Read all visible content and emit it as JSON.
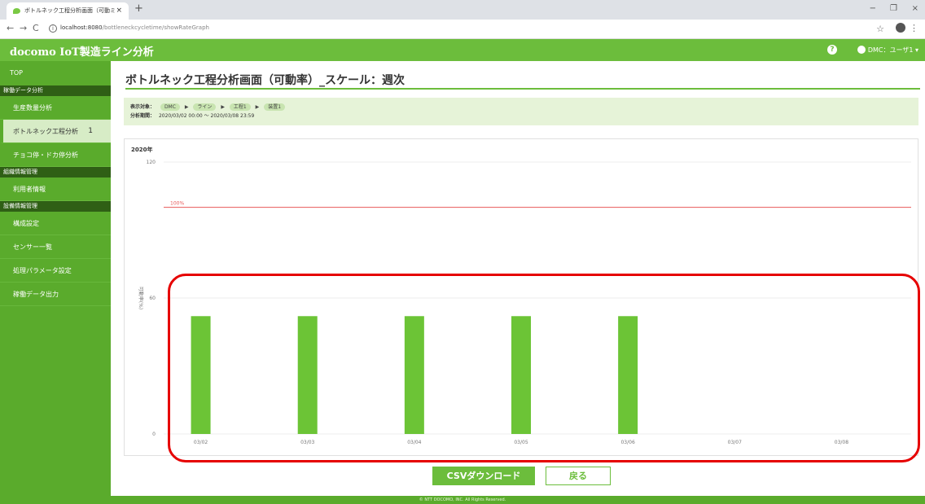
{
  "browser": {
    "tab_title": "ボトルネック工程分析画面（可動ミ",
    "tab_close": "×",
    "new_tab": "+",
    "url_host": "localhost:8080",
    "url_path": "/bottleneckcycletime/showRateGraph",
    "win_min": "−",
    "win_max": "❐",
    "win_close": "×",
    "nav_back": "←",
    "nav_fwd": "→",
    "nav_reload": "C",
    "info": "i",
    "star": "☆",
    "menu": "⋮"
  },
  "header": {
    "app_title": "docomo IoT製造ライン分析",
    "help": "?",
    "user": "DMC：ユーザ1 ▾"
  },
  "sidebar": {
    "top": "TOP",
    "sections": [
      {
        "title": "稼働データ分析",
        "items": [
          {
            "label": "生産数量分析"
          },
          {
            "label": "ボトルネック工程分析",
            "num": "1"
          },
          {
            "label": "チョコ停・ドカ停分析"
          }
        ]
      },
      {
        "title": "組織情報管理",
        "items": [
          {
            "label": "利用者情報"
          }
        ]
      },
      {
        "title": "設備情報管理",
        "items": [
          {
            "label": "構成設定"
          },
          {
            "label": "センサー一覧"
          },
          {
            "label": "処理パラメータ設定"
          },
          {
            "label": "稼働データ出力"
          }
        ]
      }
    ]
  },
  "main": {
    "title": "ボトルネック工程分析画面（可動率）_スケール：週次",
    "target_label": "表示対象：",
    "target_path": [
      "DMC",
      "ライン",
      "工程1",
      "装置1"
    ],
    "period_label": "分析期間：",
    "period_value": "2020/03/02 00:00 ～ 2020/03/08 23:59",
    "csv_button": "CSVダウンロード",
    "back_button": "戻る"
  },
  "chart_data": {
    "type": "bar",
    "year_label": "2020年",
    "categories": [
      "03/02",
      "03/03",
      "03/04",
      "03/05",
      "03/06",
      "03/07",
      "03/08"
    ],
    "values": [
      52,
      52,
      52,
      52,
      52,
      null,
      null
    ],
    "ylim": [
      0,
      120
    ],
    "yticks": [
      0,
      60,
      120
    ],
    "ylabel": "可動率(%)",
    "reference_line": {
      "value": 100,
      "label": "100%",
      "color": "#e85a5a"
    },
    "bar_color": "#6cc436",
    "grid": true
  },
  "footer": {
    "copyright": "© NTT DOCOMO, INC. All Rights Reserved."
  }
}
